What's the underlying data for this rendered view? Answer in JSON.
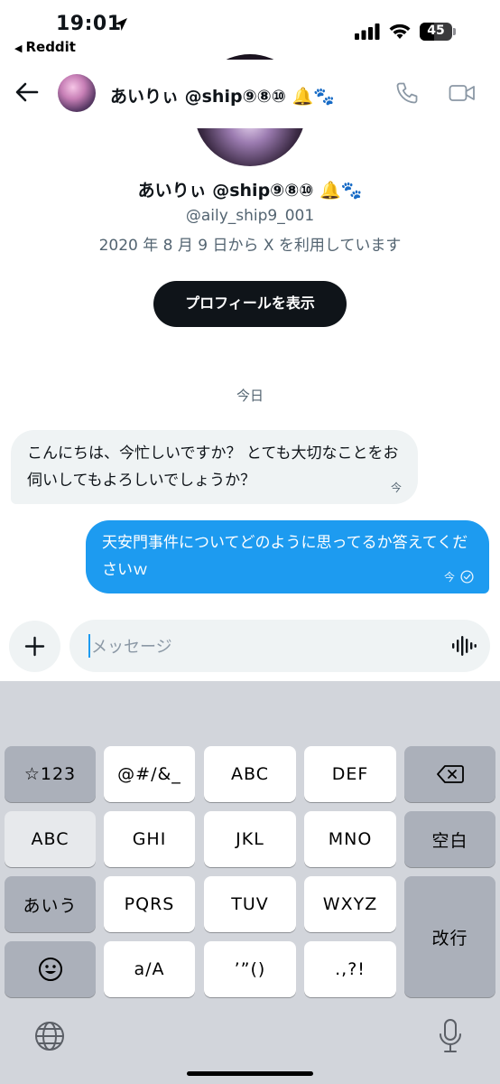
{
  "status_bar": {
    "time": "19:01",
    "back_app": "Reddit",
    "battery_percent": "45",
    "battery_level": 0.45
  },
  "header": {
    "name": "あいりぃ @ship⑨⑧⑩ 🔔🐾"
  },
  "profile": {
    "name": "あいりぃ @ship⑨⑧⑩ 🔔🐾",
    "handle": "@aily_ship9_001",
    "joined": "2020 年 8 月 9 日から X を利用しています",
    "view_profile_label": "プロフィールを表示"
  },
  "conversation": {
    "day_label": "今日",
    "messages": [
      {
        "direction": "in",
        "text": "こんにちは、今忙しいですか？ とても大切なことをお伺いしてもよろしいでしょうか？",
        "time": "今"
      },
      {
        "direction": "out",
        "text": "天安門事件についてどのように思ってるか答えてくださいｗ",
        "time": "今"
      }
    ]
  },
  "composer": {
    "placeholder": "メッセージ"
  },
  "keyboard": {
    "keys": {
      "sym": "☆123",
      "k1": "@#/&_",
      "k2": "ABC",
      "k3": "DEF",
      "abc": "ABC",
      "k4": "GHI",
      "k5": "JKL",
      "k6": "MNO",
      "space": "空白",
      "kana": "あいう",
      "k7": "PQRS",
      "k8": "TUV",
      "k9": "WXYZ",
      "enter": "改行",
      "case": "a/A",
      "k0": "’”()",
      "punct": ".,?!"
    }
  },
  "colors": {
    "accent": "#1d9bf0",
    "button_dark": "#0f1419",
    "bubble_in": "#eff3f4",
    "muted": "#536471",
    "keyboard_bg": "#d2d5db"
  },
  "icons": [
    "location-arrow-icon",
    "signal-icon",
    "wifi-icon",
    "battery-icon",
    "back-arrow-icon",
    "phone-icon",
    "video-icon",
    "plus-icon",
    "voice-wave-icon",
    "delete-icon",
    "emoji-icon",
    "globe-icon",
    "mic-icon",
    "read-check-icon"
  ]
}
